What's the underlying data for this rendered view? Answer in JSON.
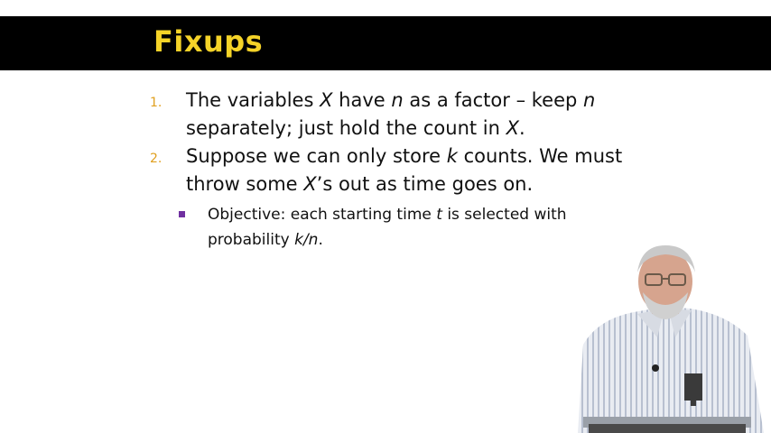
{
  "slide": {
    "title": "Fixups",
    "items": [
      {
        "number": "1.",
        "parts": [
          "The variables ",
          "X",
          " have ",
          "n",
          " as a factor – keep ",
          "n",
          " separately; just hold the count in ",
          "X",
          "."
        ]
      },
      {
        "number": "2.",
        "parts": [
          "Suppose we can only store ",
          "k",
          " counts.  We must throw some ",
          "X",
          "’s out as time goes on."
        ]
      }
    ],
    "subitem": {
      "parts": [
        "Objective: each starting time ",
        "t",
        " is selected with probability ",
        "k/n",
        "."
      ]
    }
  },
  "colors": {
    "title": "#f5d328",
    "title_bar": "#000000",
    "number": "#e0a020",
    "bullet": "#7030a0"
  },
  "icons": {
    "sub_bullet": "square-bullet-icon",
    "presenter": "presenter-video"
  }
}
